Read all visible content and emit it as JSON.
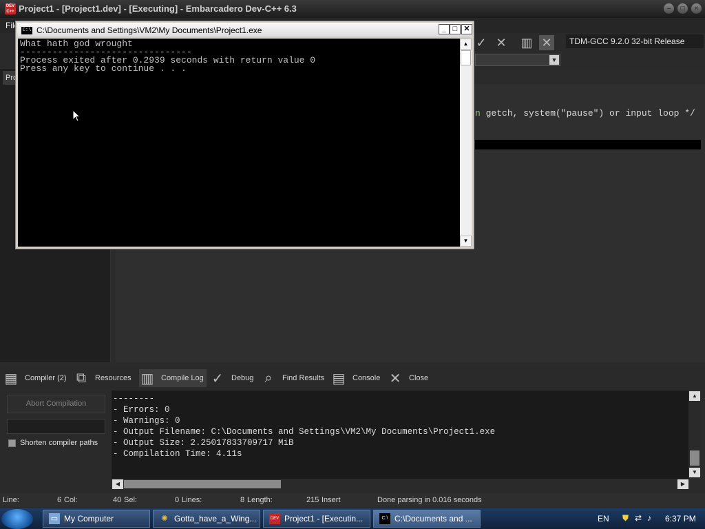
{
  "app": {
    "title": "Project1 - [Project1.dev] - [Executing] - Embarcadero Dev-C++ 6.3",
    "icon_text": "DEV C++"
  },
  "menu": {
    "file_label": "File"
  },
  "toolbar": {
    "compiler": "TDM-GCC 9.2.0 32-bit Release",
    "icons": [
      "check-icon",
      "close-icon",
      "chart-icon",
      "clear-icon"
    ]
  },
  "left_panel": {
    "tab_label": "Pro"
  },
  "editor": {
    "comment_part1": "n ",
    "call": "getch, system(\"pause\") or input loop */",
    "highlight_color": "#000000",
    "comment_color": "#8cc47a"
  },
  "console": {
    "title": "C:\\Documents and Settings\\VM2\\My Documents\\Project1.exe",
    "icon_text": "C:\\",
    "output": "What hath god wrought\n--------------------------------\nProcess exited after 0.2939 seconds with return value 0\nPress any key to continue . . ."
  },
  "bottom_tabs": [
    {
      "label": "Compiler (2)",
      "icon": "grid-icon"
    },
    {
      "label": "Resources",
      "icon": "resources-icon"
    },
    {
      "label": "Compile Log",
      "icon": "chart-icon"
    },
    {
      "label": "Debug",
      "icon": "check-icon"
    },
    {
      "label": "Find Results",
      "icon": "find-icon"
    },
    {
      "label": "Console",
      "icon": "console-icon"
    },
    {
      "label": "Close",
      "icon": "close-icon"
    }
  ],
  "compile_panel": {
    "abort_label": "Abort Compilation",
    "shorten_label": "Shorten compiler paths",
    "shorten_checked": false
  },
  "compile_log": {
    "lines": [
      "--------",
      "- Errors: 0",
      "- Warnings: 0",
      "- Output Filename: C:\\Documents and Settings\\VM2\\My Documents\\Project1.exe",
      "- Output Size: 2.25017833709717 MiB",
      "- Compilation Time: 4.11s"
    ]
  },
  "status": {
    "line_label": "Line:",
    "line_value": "6",
    "col_label": "Col:",
    "col_value": "40",
    "sel_label": "Sel:",
    "sel_value": "0",
    "lines_label": "Lines:",
    "lines_value": "8",
    "length_label": "Length:",
    "length_value": "215",
    "mode": "Insert",
    "message": "Done parsing in 0.016 seconds"
  },
  "taskbar": {
    "items": [
      {
        "label": "My Computer",
        "icon": "computer-icon"
      },
      {
        "label": "Gotta_have_a_Wing...",
        "icon": "bee-icon"
      },
      {
        "label": "Project1 - [Executin...",
        "icon": "devcpp-icon"
      },
      {
        "label": "C:\\Documents and ...",
        "icon": "console-icon"
      }
    ],
    "lang": "EN",
    "time": "6:37 PM"
  }
}
